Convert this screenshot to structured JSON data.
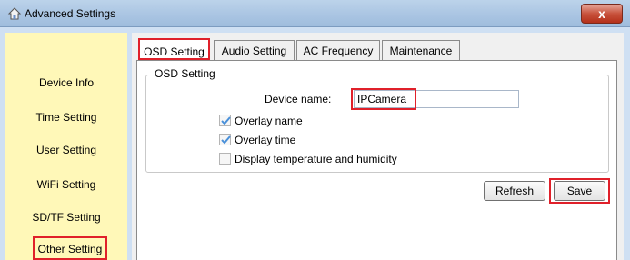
{
  "window": {
    "title": "Advanced Settings",
    "close_label": "x"
  },
  "sidebar": {
    "items": [
      {
        "label": "Device Info"
      },
      {
        "label": "Time Setting"
      },
      {
        "label": "User Setting"
      },
      {
        "label": "WiFi Setting"
      },
      {
        "label": "SD/TF Setting"
      },
      {
        "label": "Other Setting",
        "selected": true
      }
    ]
  },
  "tabs": [
    {
      "label": "OSD Setting",
      "active": true
    },
    {
      "label": "Audio Setting"
    },
    {
      "label": "AC Frequency"
    },
    {
      "label": "Maintenance"
    }
  ],
  "osd": {
    "group_title": "OSD Setting",
    "device_name_label": "Device name:",
    "device_name_value": "IPCamera",
    "overlay_name": {
      "label": "Overlay name",
      "checked": true
    },
    "overlay_time": {
      "label": "Overlay time",
      "checked": true
    },
    "display_temp": {
      "label": "Display temperature and humidity",
      "checked": false
    }
  },
  "buttons": {
    "refresh": "Refresh",
    "save": "Save"
  },
  "colors": {
    "highlight": "#e0202a",
    "sidebar_bg": "#fff8b8",
    "titlebar": "#a9c4e2",
    "check_blue": "#4a90d9"
  }
}
